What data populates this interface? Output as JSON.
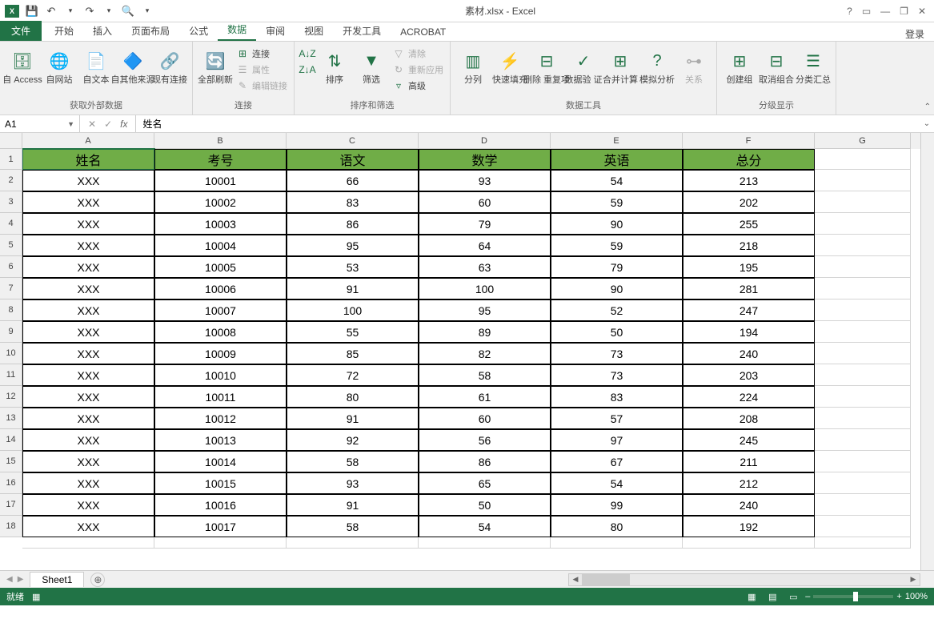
{
  "title_bar": {
    "filename": "素材.xlsx - Excel",
    "qat": {
      "excel": "X",
      "save": "💾",
      "undo": "↶",
      "redo": "↷",
      "dropdown": "▾",
      "preview": "🔍",
      "dropdown2": "▾"
    },
    "ctrls": {
      "help": "?",
      "ribbon": "▭",
      "min": "—",
      "restore": "❐",
      "close": "✕"
    }
  },
  "tabs": {
    "file": "文件",
    "start": "开始",
    "insert": "插入",
    "page": "页面布局",
    "formula": "公式",
    "data": "数据",
    "review": "审阅",
    "view": "视图",
    "dev": "开发工具",
    "acrobat": "ACROBAT",
    "login": "登录"
  },
  "ribbon": {
    "g1": {
      "label": "获取外部数据",
      "access": "自 Access",
      "web": "自网站",
      "text": "自文本",
      "other": "自其他来源",
      "existing": "现有连接"
    },
    "g2": {
      "label": "连接",
      "refresh": "全部刷新",
      "conn": "连接",
      "prop": "属性",
      "edit": "编辑链接"
    },
    "g3": {
      "label": "排序和筛选",
      "sortaz": "A↓Z",
      "sortza": "Z↓A",
      "sort": "排序",
      "filter": "筛选",
      "clear": "清除",
      "reapply": "重新应用",
      "adv": "高级"
    },
    "g4": {
      "label": "数据工具",
      "split": "分列",
      "flash": "快速填充",
      "dup": "删除\n重复项",
      "valid": "数据验\n证",
      "consol": "合并计算",
      "whatif": "模拟分析",
      "relation": "关系"
    },
    "g5": {
      "label": "分级显示",
      "group": "创建组",
      "ungroup": "取消组合",
      "subtotal": "分类汇总"
    }
  },
  "formula": {
    "name": "A1",
    "value": "姓名",
    "fx": "fx",
    "cancel": "✕",
    "ok": "✓"
  },
  "grid": {
    "cols": [
      "A",
      "B",
      "C",
      "D",
      "E",
      "F",
      "G"
    ],
    "rownums": [
      "1",
      "2",
      "3",
      "4",
      "5",
      "6",
      "7",
      "8",
      "9",
      "10",
      "11",
      "12",
      "13",
      "14",
      "15",
      "16",
      "17",
      "18"
    ],
    "header": [
      "姓名",
      "考号",
      "语文",
      "数学",
      "英语",
      "总分"
    ],
    "rows": [
      [
        "XXX",
        "10001",
        "66",
        "93",
        "54",
        "213"
      ],
      [
        "XXX",
        "10002",
        "83",
        "60",
        "59",
        "202"
      ],
      [
        "XXX",
        "10003",
        "86",
        "79",
        "90",
        "255"
      ],
      [
        "XXX",
        "10004",
        "95",
        "64",
        "59",
        "218"
      ],
      [
        "XXX",
        "10005",
        "53",
        "63",
        "79",
        "195"
      ],
      [
        "XXX",
        "10006",
        "91",
        "100",
        "90",
        "281"
      ],
      [
        "XXX",
        "10007",
        "100",
        "95",
        "52",
        "247"
      ],
      [
        "XXX",
        "10008",
        "55",
        "89",
        "50",
        "194"
      ],
      [
        "XXX",
        "10009",
        "85",
        "82",
        "73",
        "240"
      ],
      [
        "XXX",
        "10010",
        "72",
        "58",
        "73",
        "203"
      ],
      [
        "XXX",
        "10011",
        "80",
        "61",
        "83",
        "224"
      ],
      [
        "XXX",
        "10012",
        "91",
        "60",
        "57",
        "208"
      ],
      [
        "XXX",
        "10013",
        "92",
        "56",
        "97",
        "245"
      ],
      [
        "XXX",
        "10014",
        "58",
        "86",
        "67",
        "211"
      ],
      [
        "XXX",
        "10015",
        "93",
        "65",
        "54",
        "212"
      ],
      [
        "XXX",
        "10016",
        "91",
        "50",
        "99",
        "240"
      ],
      [
        "XXX",
        "10017",
        "58",
        "54",
        "80",
        "192"
      ]
    ]
  },
  "sheet": {
    "name": "Sheet1",
    "nav_prev": "◀",
    "nav_next": "▶",
    "add": "⊕"
  },
  "status": {
    "ready": "就绪",
    "rec": "▦",
    "zoom": "100%",
    "minus": "–",
    "plus": "+"
  }
}
